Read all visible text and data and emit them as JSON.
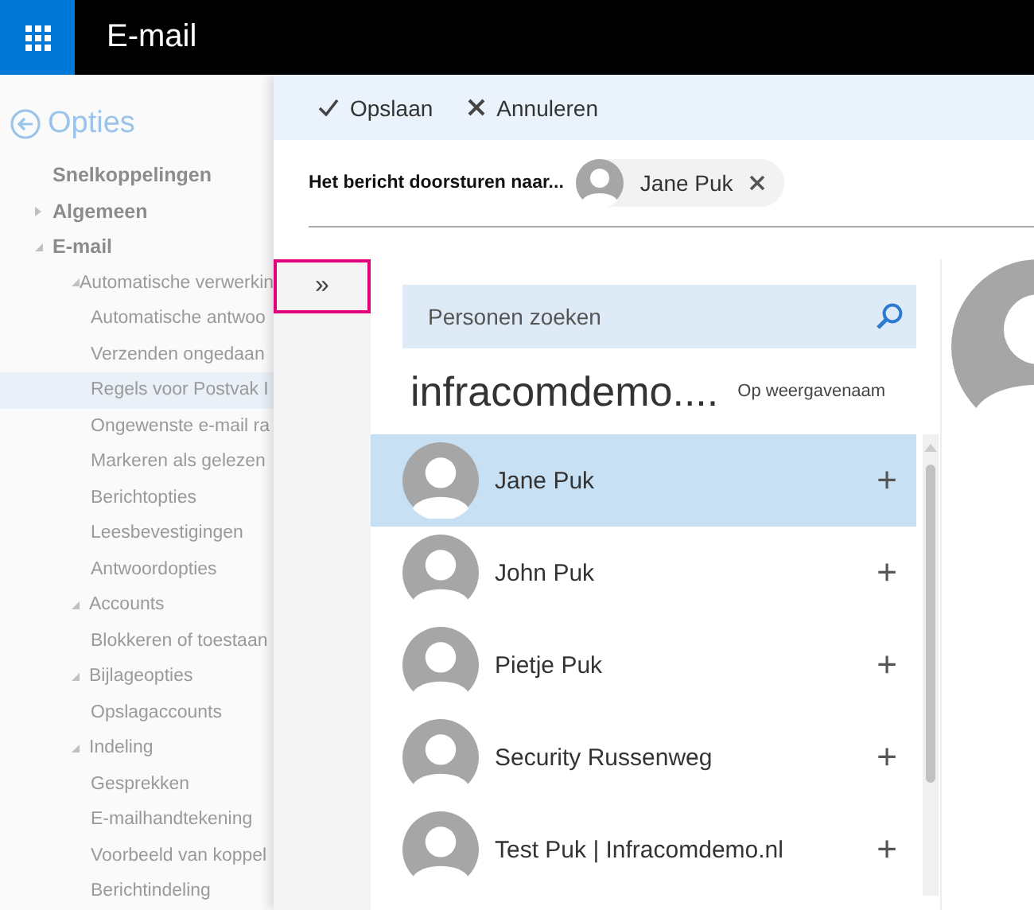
{
  "top_bar": {
    "title": "E-mail"
  },
  "sidebar": {
    "title": "Opties",
    "items": [
      {
        "label": "Snelkoppelingen",
        "selected": false
      },
      {
        "label": "Algemeen",
        "expanded": false,
        "selected": false
      },
      {
        "label": "E-mail",
        "expanded": true,
        "selected": false,
        "children": [
          {
            "label": "Automatische verwerkin",
            "expanded": true,
            "selected": false,
            "children": [
              {
                "label": "Automatische antwoo",
                "selected": false
              },
              {
                "label": "Verzenden ongedaan",
                "selected": false
              },
              {
                "label": "Regels voor Postvak I",
                "selected": true
              },
              {
                "label": "Ongewenste e-mail ra",
                "selected": false
              },
              {
                "label": "Markeren als gelezen",
                "selected": false
              },
              {
                "label": "Berichtopties",
                "selected": false
              },
              {
                "label": "Leesbevestigingen",
                "selected": false
              },
              {
                "label": "Antwoordopties",
                "selected": false
              }
            ]
          },
          {
            "label": "Accounts",
            "expanded": true,
            "selected": false,
            "children": [
              {
                "label": "Blokkeren of toestaan",
                "selected": false
              }
            ]
          },
          {
            "label": "Bijlageopties",
            "expanded": true,
            "selected": false,
            "children": [
              {
                "label": "Opslagaccounts",
                "selected": false
              }
            ]
          },
          {
            "label": "Indeling",
            "expanded": true,
            "selected": false,
            "children": [
              {
                "label": "Gesprekken",
                "selected": false
              },
              {
                "label": "E-mailhandtekening",
                "selected": false
              },
              {
                "label": "Voorbeeld van koppel",
                "selected": false
              },
              {
                "label": "Berichtindeling",
                "selected": false
              }
            ]
          }
        ]
      }
    ]
  },
  "toolbar": {
    "buttons": [
      {
        "label": "Opslaan",
        "kind": "save"
      },
      {
        "label": "Annuleren",
        "kind": "cancel"
      }
    ]
  },
  "recipient": {
    "label": "Het bericht doorsturen naar...",
    "chip": {
      "name": "Jane Puk"
    }
  },
  "expand_button": {
    "label": "»"
  },
  "people_picker": {
    "search": {
      "placeholder": "Personen zoeken"
    },
    "heading": "infracomdemo....",
    "sort": "Op weergavenaam",
    "people": [
      {
        "name": "Jane Puk",
        "selected": true,
        "action": "+"
      },
      {
        "name": "John Puk",
        "selected": false,
        "action": "+"
      },
      {
        "name": "Pietje Puk",
        "selected": false,
        "action": "+"
      },
      {
        "name": "Security Russenweg",
        "selected": false,
        "action": "+"
      },
      {
        "name": "Test Puk | Infracomdemo.nl",
        "selected": false,
        "action": "+"
      }
    ]
  }
}
